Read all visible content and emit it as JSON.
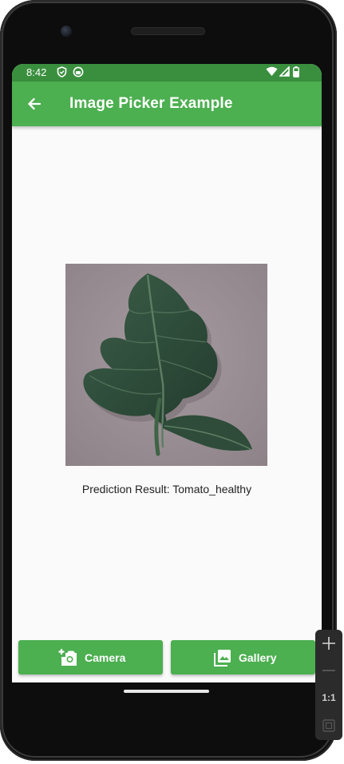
{
  "status_bar": {
    "time": "8:42"
  },
  "app_bar": {
    "title": "Image Picker Example"
  },
  "main": {
    "prediction_text": "Prediction Result: Tomato_healthy"
  },
  "buttons": {
    "camera_label": "Camera",
    "gallery_label": "Gallery"
  },
  "emulator_toolbar": {
    "ratio_label": "1:1"
  },
  "colors": {
    "primary": "#4caf50",
    "status_bar": "#3a8f3e",
    "background": "#fafafa"
  }
}
